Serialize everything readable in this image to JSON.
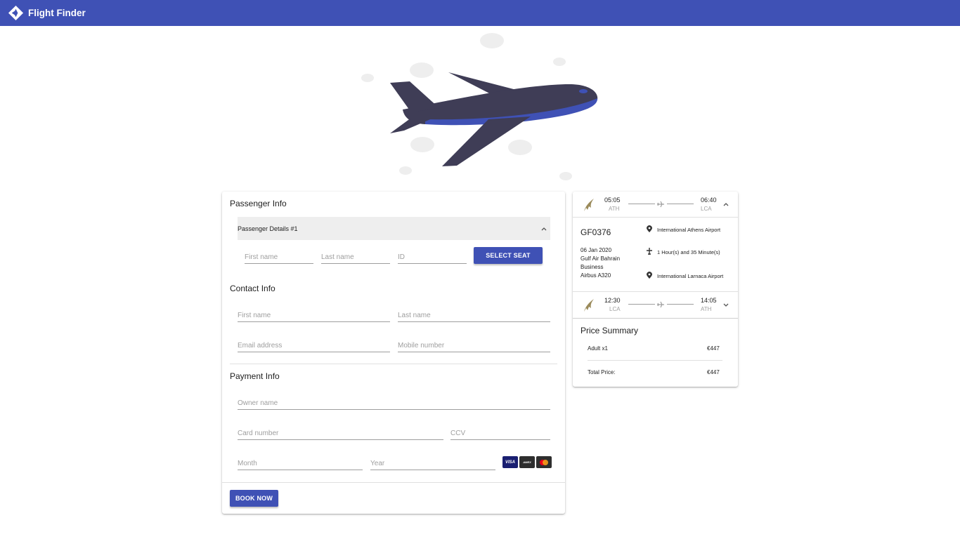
{
  "app": {
    "title": "Flight Finder"
  },
  "passenger": {
    "title": "Passenger Info",
    "panel_title": "Passenger Details #1",
    "first_name_placeholder": "First name",
    "last_name_placeholder": "Last name",
    "id_placeholder": "ID",
    "select_seat_label": "SELECT SEAT"
  },
  "contact": {
    "title": "Contact Info",
    "first_name_placeholder": "First name",
    "last_name_placeholder": "Last name",
    "email_placeholder": "Email address",
    "mobile_placeholder": "Mobile number"
  },
  "payment": {
    "title": "Payment Info",
    "owner_placeholder": "Owner name",
    "card_placeholder": "Card number",
    "ccv_placeholder": "CCV",
    "month_placeholder": "Month",
    "year_placeholder": "Year",
    "card_brands": [
      "VISA",
      "AMEX",
      "MC"
    ]
  },
  "book_label": "BOOK NOW",
  "outbound": {
    "depart_time": "05:05",
    "depart_code": "ATH",
    "arrive_time": "06:40",
    "arrive_code": "LCA",
    "flight_no": "GF0376",
    "date": "06 Jan 2020",
    "airline": "Gulf Air Bahrain",
    "cabin": "Business",
    "aircraft": "Airbus A320",
    "origin_airport": "International Athens Airport",
    "duration": "1 Hour(s) and 35 Minute(s)",
    "destination_airport": "International Larnaca Airport"
  },
  "return": {
    "depart_time": "12:30",
    "depart_code": "LCA",
    "arrive_time": "14:05",
    "arrive_code": "ATH"
  },
  "price": {
    "title": "Price Summary",
    "adult_label": "Adult x1",
    "adult_value": "€447",
    "total_label": "Total Price:",
    "total_value": "€447"
  },
  "colors": {
    "primary": "#3f51b5",
    "plane_body": "#3f3d56",
    "plane_accent": "#3f51b5"
  }
}
